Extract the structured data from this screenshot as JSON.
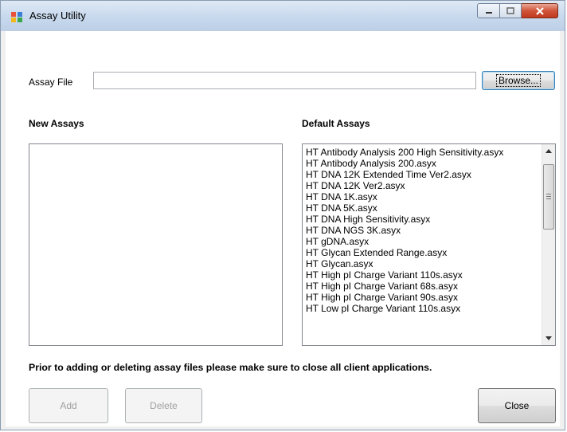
{
  "window": {
    "title": "Assay Utility",
    "buttons": {
      "minimize": "minimize-icon",
      "maximize": "maximize-icon",
      "close": "close-icon"
    }
  },
  "assay_file": {
    "label": "Assay File",
    "value": "",
    "browse_label": "Browse..."
  },
  "new_assays": {
    "heading": "New Assays",
    "items": []
  },
  "default_assays": {
    "heading": "Default Assays",
    "items": [
      "HT Antibody Analysis 200 High Sensitivity.asyx",
      "HT Antibody Analysis 200.asyx",
      "HT DNA 12K Extended Time Ver2.asyx",
      "HT DNA 12K Ver2.asyx",
      "HT DNA 1K.asyx",
      "HT DNA 5K.asyx",
      "HT DNA High Sensitivity.asyx",
      "HT DNA NGS 3K.asyx",
      "HT gDNA.asyx",
      "HT Glycan Extended Range.asyx",
      "HT Glycan.asyx",
      "HT High pI Charge Variant 110s.asyx",
      "HT High pI Charge Variant 68s.asyx",
      "HT High pI Charge Variant 90s.asyx",
      "HT Low pI Charge Variant 110s.asyx"
    ]
  },
  "notice": "Prior to adding or deleting assay files please make sure to close all client applications.",
  "buttons": {
    "add": "Add",
    "delete": "Delete",
    "close": "Close"
  }
}
